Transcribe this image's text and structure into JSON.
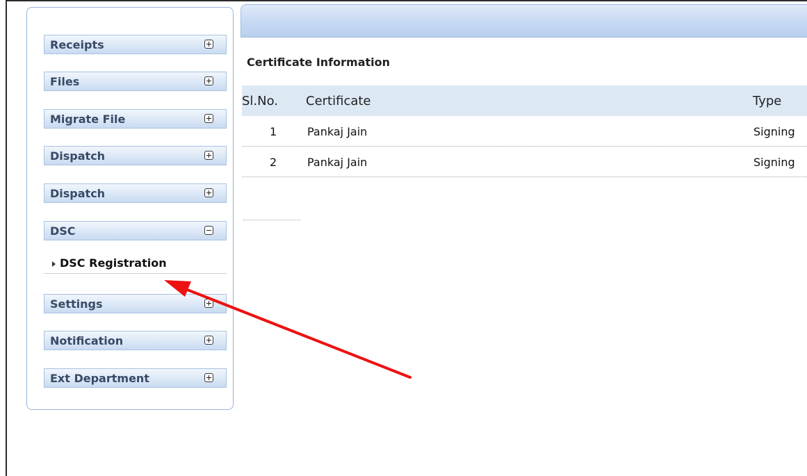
{
  "sidebar": {
    "items": [
      {
        "label": "Receipts",
        "expanded": false
      },
      {
        "label": "Files",
        "expanded": false
      },
      {
        "label": "Migrate File",
        "expanded": false
      },
      {
        "label": "Dispatch",
        "expanded": false
      },
      {
        "label": "Dispatch",
        "expanded": false
      },
      {
        "label": "DSC",
        "expanded": true,
        "children": [
          {
            "label": "DSC Registration"
          }
        ]
      },
      {
        "label": "Settings",
        "expanded": false
      },
      {
        "label": "Notification",
        "expanded": false
      },
      {
        "label": "Ext Department",
        "expanded": false
      }
    ]
  },
  "main": {
    "section_title": "Certificate Information",
    "table": {
      "columns": [
        "Sl.No.",
        "Certificate",
        "Type"
      ],
      "rows": [
        [
          "1",
          "Pankaj Jain",
          "Signing"
        ],
        [
          "2",
          "Pankaj Jain",
          "Signing"
        ]
      ]
    }
  },
  "colors": {
    "menu_gradient_top": "#f1f6fc",
    "menu_gradient_bottom": "#c9dbf1",
    "table_header_bg": "#dde8f5",
    "annotation_arrow": "#ee1111"
  }
}
